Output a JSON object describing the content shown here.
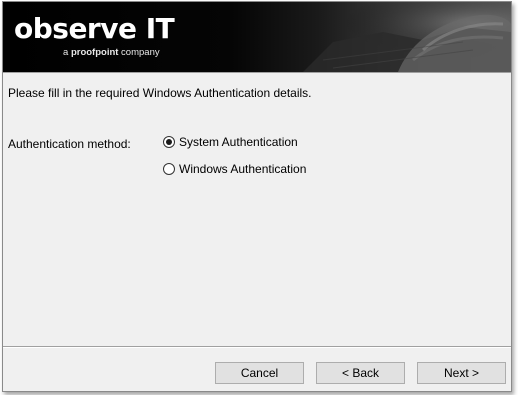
{
  "banner": {
    "logo_main": "observe IT",
    "logo_sub_prefix": "a ",
    "logo_sub_brand": "proofpoint",
    "logo_sub_suffix": " company"
  },
  "content": {
    "instruction": "Please fill in the required Windows Authentication details.",
    "auth_method_label": "Authentication method:",
    "options": [
      {
        "label": "System Authentication",
        "selected": true
      },
      {
        "label": "Windows Authentication",
        "selected": false
      }
    ]
  },
  "buttons": {
    "cancel": "Cancel",
    "back": "< Back",
    "next": "Next >"
  }
}
